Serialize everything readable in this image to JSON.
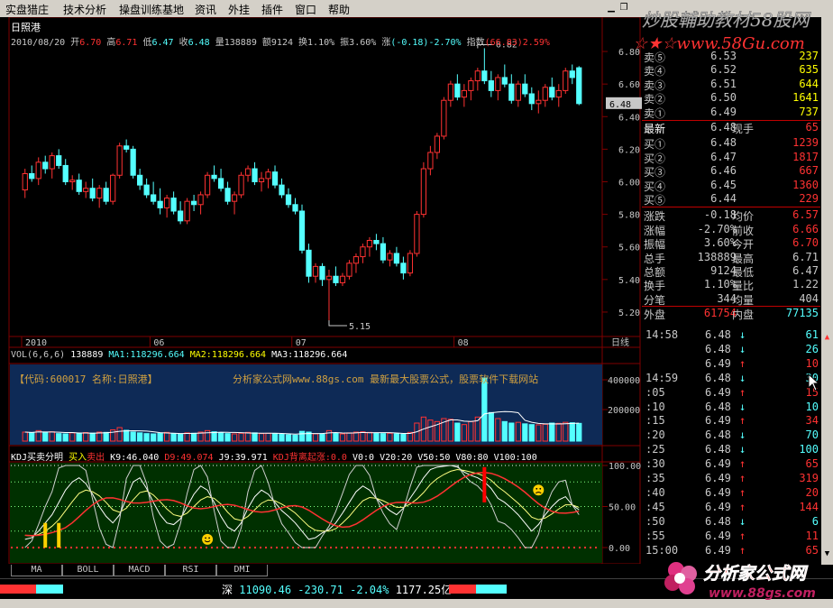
{
  "menu": [
    "实盘猎庄",
    "技术分析",
    "操盘训练基地",
    "资讯",
    "外挂",
    "插件",
    "窗口",
    "帮助"
  ],
  "watermark": {
    "line1": "炒股輔助教材58股网",
    "line2": "☆★☆www.58Gu.com"
  },
  "stock_name": "日照港",
  "info": {
    "date": "2010/08/20",
    "open_label": "开",
    "open": "6.70",
    "high_label": "高",
    "high": "6.71",
    "low_label": "低",
    "low": "6.47",
    "close_label": "收",
    "close": "6.48",
    "vol_label": "量",
    "vol": "138889",
    "amt_label": "额",
    "amt": "9124",
    "turn_label": "换",
    "turn": "1.10%",
    "amp_label": "振",
    "amp": "3.60%",
    "chg_label": "涨",
    "chg": "(-0.18)-2.70%",
    "index_label": "指数",
    "index": "(66.83)",
    "index_pct": "2.59%"
  },
  "price_axis": [
    "6.80",
    "6.60",
    "6.40",
    "6.20",
    "6.00",
    "5.80",
    "5.60",
    "5.40",
    "5.20"
  ],
  "current_price_tag": "6.48",
  "peak_label": "6.82",
  "trough_label": "5.15",
  "date_axis": [
    "2010",
    "06",
    "07",
    "08"
  ],
  "period_label": "日线",
  "vol_header": {
    "name": "VOL(6,6,6)",
    "vol": "138889",
    "ma1": "MA1:118296.664",
    "ma2": "MA2:118296.664",
    "ma3": "MA3:118296.664"
  },
  "vol_banner": {
    "code": "【代码:600017 名称:日照港】",
    "ad": "分析家公式网www.88gs.com 最新最大股票公式，股票软件下载网站"
  },
  "vol_axis": [
    "400000",
    "200000"
  ],
  "kdj_header": {
    "name": "KDJ买卖分明",
    "buy": "买入",
    "sell": "卖出",
    "k": "K9:46.040",
    "d": "D9:49.074",
    "j": "J9:39.971",
    "alert": "KDJ背离起涨:0.0",
    "v0": "V0:0",
    "v20": "V20:20",
    "v50": "V50:50",
    "v80": "V80:80",
    "v100": "V100:100"
  },
  "kdj_axis": [
    "100.00",
    "50.00",
    "0.00"
  ],
  "quote": {
    "asks": [
      {
        "label": "卖⑤",
        "price": "6.53",
        "vol": "237"
      },
      {
        "label": "卖④",
        "price": "6.52",
        "vol": "635"
      },
      {
        "label": "卖③",
        "price": "6.51",
        "vol": "644"
      },
      {
        "label": "卖②",
        "price": "6.50",
        "vol": "1641"
      },
      {
        "label": "卖①",
        "price": "6.49",
        "vol": "737"
      }
    ],
    "last": {
      "label": "最新",
      "price": "6.48",
      "extra_label": "现手",
      "extra": "65"
    },
    "bids": [
      {
        "label": "买①",
        "price": "6.48",
        "vol": "1239"
      },
      {
        "label": "买②",
        "price": "6.47",
        "vol": "1817"
      },
      {
        "label": "买③",
        "price": "6.46",
        "vol": "667"
      },
      {
        "label": "买④",
        "price": "6.45",
        "vol": "1360"
      },
      {
        "label": "买⑤",
        "price": "6.44",
        "vol": "229"
      }
    ],
    "stats": [
      {
        "l1": "涨跌",
        "v1": "-0.18",
        "l2": "均价",
        "v2": "6.57"
      },
      {
        "l1": "涨幅",
        "v1": "-2.70%",
        "l2": "前收",
        "v2": "6.66"
      },
      {
        "l1": "振幅",
        "v1": "3.60%",
        "l2": "今开",
        "v2": "6.70"
      },
      {
        "l1": "总手",
        "v1": "138889",
        "l2": "最高",
        "v2": "6.71"
      },
      {
        "l1": "总额",
        "v1": "9124",
        "l2": "最低",
        "v2": "6.47"
      },
      {
        "l1": "换手",
        "v1": "1.10%",
        "l2": "量比",
        "v2": "1.22"
      },
      {
        "l1": "分笔",
        "v1": "344",
        "l2": "均量",
        "v2": "404"
      }
    ],
    "outer": {
      "label": "外盘",
      "value": "61754",
      "inner_label": "内盘",
      "inner_value": "77135"
    }
  },
  "ticks": [
    {
      "time": "14:58",
      "price": "6.48",
      "dir": "↓",
      "vol": "61"
    },
    {
      "time": "",
      "price": "6.48",
      "dir": "↓",
      "vol": "26"
    },
    {
      "time": "",
      "price": "6.49",
      "dir": "↑",
      "vol": "10"
    },
    {
      "time": "14:59",
      "price": "6.48",
      "dir": "↓",
      "vol": "30"
    },
    {
      "time": ":05",
      "price": "6.49",
      "dir": "↑",
      "vol": "15"
    },
    {
      "time": ":10",
      "price": "6.48",
      "dir": "↓",
      "vol": "10"
    },
    {
      "time": ":15",
      "price": "6.49",
      "dir": "↑",
      "vol": "34"
    },
    {
      "time": ":20",
      "price": "6.48",
      "dir": "↓",
      "vol": "70"
    },
    {
      "time": ":25",
      "price": "6.48",
      "dir": "↓",
      "vol": "100"
    },
    {
      "time": ":30",
      "price": "6.49",
      "dir": "↑",
      "vol": "65"
    },
    {
      "time": ":35",
      "price": "6.49",
      "dir": "↑",
      "vol": "319"
    },
    {
      "time": ":40",
      "price": "6.49",
      "dir": "↑",
      "vol": "20"
    },
    {
      "time": ":45",
      "price": "6.49",
      "dir": "↑",
      "vol": "144"
    },
    {
      "time": ":50",
      "price": "6.48",
      "dir": "↓",
      "vol": "6"
    },
    {
      "time": ":55",
      "price": "6.49",
      "dir": "↑",
      "vol": "11"
    },
    {
      "time": "15:00",
      "price": "6.49",
      "dir": "↑",
      "vol": "65"
    }
  ],
  "tabs": [
    "MA",
    "BOLL",
    "MACD",
    "RSI",
    "DMI"
  ],
  "status": {
    "index_name": "深",
    "index_value": "11090.46",
    "index_chg": "-230.71",
    "index_pct": "-2.04%",
    "index_amt": "1177.25亿"
  },
  "logo": {
    "text": "分析家公式网",
    "url": "www.88gs.com"
  },
  "colors": {
    "up": "#ff3232",
    "down": "#54ffff",
    "bg": "#000000",
    "grid": "#800000",
    "vol_bg": "#0e2a56",
    "kdj_bg": "#003000"
  },
  "chart_data": {
    "type": "candlestick",
    "ylim": [
      5.1,
      6.9
    ],
    "candles": [
      [
        5.95,
        6.08,
        5.9,
        6.05
      ],
      [
        6.05,
        6.1,
        6.0,
        6.02
      ],
      [
        6.02,
        6.15,
        5.98,
        6.12
      ],
      [
        6.12,
        6.16,
        6.05,
        6.08
      ],
      [
        6.08,
        6.18,
        6.02,
        6.16
      ],
      [
        6.16,
        6.2,
        6.08,
        6.1
      ],
      [
        6.1,
        6.14,
        5.98,
        6.0
      ],
      [
        6.0,
        6.04,
        5.95,
        6.01
      ],
      [
        6.01,
        6.05,
        5.92,
        5.94
      ],
      [
        5.94,
        6.0,
        5.9,
        5.96
      ],
      [
        5.96,
        6.02,
        5.88,
        5.9
      ],
      [
        5.9,
        5.98,
        5.84,
        5.96
      ],
      [
        5.96,
        6.0,
        5.86,
        5.88
      ],
      [
        5.88,
        6.05,
        5.86,
        6.04
      ],
      [
        6.04,
        6.24,
        6.02,
        6.22
      ],
      [
        6.22,
        6.26,
        6.18,
        6.2
      ],
      [
        6.2,
        6.22,
        6.02,
        6.04
      ],
      [
        6.04,
        6.08,
        5.95,
        5.98
      ],
      [
        5.98,
        6.02,
        5.9,
        5.92
      ],
      [
        5.92,
        6.0,
        5.86,
        5.88
      ],
      [
        5.88,
        5.96,
        5.8,
        5.84
      ],
      [
        5.84,
        5.92,
        5.78,
        5.9
      ],
      [
        5.9,
        5.94,
        5.8,
        5.82
      ],
      [
        5.82,
        5.88,
        5.74,
        5.76
      ],
      [
        5.76,
        5.9,
        5.74,
        5.88
      ],
      [
        5.88,
        5.92,
        5.82,
        5.86
      ],
      [
        5.86,
        5.94,
        5.8,
        5.92
      ],
      [
        5.92,
        6.06,
        5.9,
        6.04
      ],
      [
        6.04,
        6.1,
        6.0,
        6.02
      ],
      [
        6.02,
        6.08,
        5.94,
        5.96
      ],
      [
        5.96,
        6.0,
        5.86,
        5.88
      ],
      [
        5.88,
        5.94,
        5.8,
        5.92
      ],
      [
        5.92,
        6.06,
        5.9,
        6.04
      ],
      [
        6.04,
        6.1,
        6.0,
        6.08
      ],
      [
        6.08,
        6.12,
        5.98,
        6.0
      ],
      [
        6.0,
        6.06,
        5.94,
        6.02
      ],
      [
        6.02,
        6.08,
        5.96,
        6.06
      ],
      [
        6.06,
        6.1,
        5.96,
        5.98
      ],
      [
        5.98,
        6.02,
        5.9,
        5.92
      ],
      [
        5.92,
        5.96,
        5.84,
        5.86
      ],
      [
        5.86,
        5.9,
        5.8,
        5.82
      ],
      [
        5.82,
        5.86,
        5.56,
        5.58
      ],
      [
        5.58,
        5.62,
        5.38,
        5.42
      ],
      [
        5.42,
        5.5,
        5.38,
        5.48
      ],
      [
        5.48,
        5.5,
        5.36,
        5.4
      ],
      [
        5.4,
        5.46,
        5.15,
        5.42
      ],
      [
        5.42,
        5.48,
        5.36,
        5.38
      ],
      [
        5.38,
        5.44,
        5.36,
        5.42
      ],
      [
        5.42,
        5.52,
        5.4,
        5.5
      ],
      [
        5.5,
        5.56,
        5.44,
        5.54
      ],
      [
        5.54,
        5.62,
        5.5,
        5.6
      ],
      [
        5.6,
        5.66,
        5.54,
        5.64
      ],
      [
        5.64,
        5.68,
        5.58,
        5.62
      ],
      [
        5.62,
        5.66,
        5.5,
        5.52
      ],
      [
        5.52,
        5.58,
        5.48,
        5.56
      ],
      [
        5.56,
        5.6,
        5.48,
        5.5
      ],
      [
        5.5,
        5.54,
        5.4,
        5.44
      ],
      [
        5.44,
        5.58,
        5.42,
        5.56
      ],
      [
        5.56,
        5.82,
        5.54,
        5.8
      ],
      [
        5.8,
        6.12,
        5.78,
        6.08
      ],
      [
        6.08,
        6.22,
        6.04,
        6.18
      ],
      [
        6.18,
        6.3,
        6.14,
        6.28
      ],
      [
        6.28,
        6.52,
        6.26,
        6.5
      ],
      [
        6.5,
        6.62,
        6.46,
        6.6
      ],
      [
        6.6,
        6.66,
        6.5,
        6.52
      ],
      [
        6.52,
        6.6,
        6.46,
        6.56
      ],
      [
        6.56,
        6.64,
        6.5,
        6.62
      ],
      [
        6.62,
        6.7,
        6.56,
        6.68
      ],
      [
        6.68,
        6.82,
        6.6,
        6.62
      ],
      [
        6.62,
        6.68,
        6.52,
        6.56
      ],
      [
        6.56,
        6.66,
        6.5,
        6.64
      ],
      [
        6.64,
        6.72,
        6.58,
        6.6
      ],
      [
        6.6,
        6.66,
        6.48,
        6.5
      ],
      [
        6.5,
        6.62,
        6.46,
        6.6
      ],
      [
        6.6,
        6.66,
        6.52,
        6.54
      ],
      [
        6.54,
        6.58,
        6.44,
        6.48
      ],
      [
        6.48,
        6.56,
        6.42,
        6.5
      ],
      [
        6.5,
        6.6,
        6.46,
        6.58
      ],
      [
        6.58,
        6.64,
        6.5,
        6.52
      ],
      [
        6.52,
        6.6,
        6.46,
        6.56
      ],
      [
        6.56,
        6.7,
        6.54,
        6.68
      ],
      [
        6.68,
        6.72,
        6.6,
        6.64
      ],
      [
        6.7,
        6.71,
        6.47,
        6.48
      ]
    ],
    "volume": [
      60,
      55,
      70,
      58,
      62,
      50,
      48,
      55,
      52,
      57,
      53,
      60,
      58,
      75,
      90,
      72,
      60,
      55,
      50,
      48,
      52,
      58,
      50,
      45,
      55,
      52,
      60,
      70,
      62,
      55,
      50,
      48,
      52,
      58,
      55,
      50,
      52,
      48,
      45,
      42,
      40,
      65,
      60,
      48,
      45,
      70,
      52,
      48,
      55,
      60,
      62,
      58,
      54,
      50,
      52,
      48,
      46,
      58,
      120,
      160,
      140,
      130,
      150,
      145,
      120,
      110,
      130,
      160,
      420,
      190,
      150,
      130,
      120,
      125,
      115,
      110,
      108,
      112,
      120,
      118,
      125,
      122,
      118
    ],
    "kdj_k": [
      10,
      12,
      20,
      30,
      40,
      55,
      70,
      80,
      85,
      78,
      65,
      50,
      38,
      30,
      40,
      60,
      80,
      85,
      72,
      55,
      40,
      30,
      28,
      35,
      50,
      65,
      75,
      70,
      55,
      38,
      25,
      20,
      30,
      48,
      62,
      70,
      65,
      55,
      45,
      38,
      30,
      20,
      10,
      12,
      18,
      22,
      30,
      42,
      55,
      68,
      75,
      70,
      60,
      52,
      45,
      40,
      48,
      60,
      72,
      85,
      95,
      98,
      99,
      100,
      98,
      92,
      88,
      85,
      80,
      72,
      60,
      55,
      48,
      40,
      30,
      20,
      28,
      40,
      50,
      58,
      62,
      52,
      46
    ],
    "kdj_d": [
      15,
      14,
      16,
      20,
      26,
      34,
      45,
      56,
      66,
      70,
      68,
      63,
      55,
      46,
      43,
      48,
      58,
      67,
      69,
      64,
      56,
      47,
      40,
      38,
      42,
      50,
      58,
      62,
      60,
      53,
      43,
      35,
      33,
      38,
      46,
      54,
      58,
      57,
      53,
      48,
      42,
      34,
      26,
      21,
      20,
      20,
      23,
      30,
      38,
      48,
      57,
      61,
      60,
      57,
      53,
      49,
      49,
      53,
      59,
      67,
      77,
      84,
      89,
      93,
      95,
      94,
      92,
      90,
      87,
      82,
      74,
      68,
      61,
      54,
      46,
      37,
      34,
      36,
      41,
      47,
      52,
      52,
      49
    ]
  }
}
